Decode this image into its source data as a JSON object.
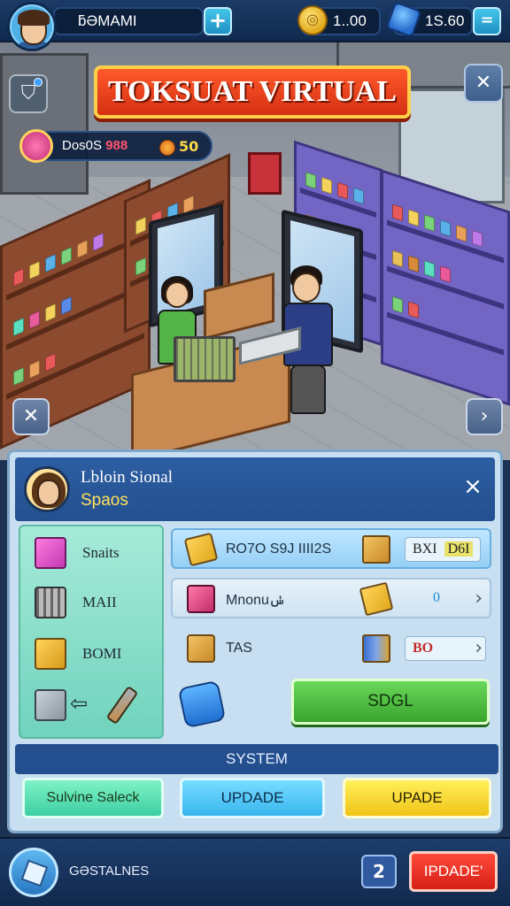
{
  "player": {
    "name": "ƃƏMAMI",
    "add_label": "+"
  },
  "currency": {
    "coins": "1..00",
    "gems": "1S.60",
    "menu_label": "="
  },
  "banner": {
    "title": "TOKSUAT VIRTUAL",
    "close_label": "✕"
  },
  "shop_info": {
    "label": "Dos0S",
    "value_red": "988",
    "coin_value": "50"
  },
  "nav": {
    "left_label": "✕",
    "right_label": "›"
  },
  "panel": {
    "name": "Lbloin Sional",
    "subtitle": "Spaos",
    "close_label": "×",
    "inventory": [
      {
        "label": "Snaits"
      },
      {
        "label": "MAII"
      },
      {
        "label": "BOMI"
      },
      {
        "label": "⇦"
      }
    ],
    "rows": [
      {
        "label": "RO7O S9J IIII2S",
        "tag": "BXI",
        "tag_accent": "D6I"
      },
      {
        "label": "Mnonuݭ",
        "tag": "0",
        "chevron": "›"
      },
      {
        "label": "TAS",
        "tag": "BO",
        "chevron": "›"
      }
    ],
    "sell_label": "SDGL",
    "system_label": "SYSTEM",
    "buttons": {
      "a": "Sulvine Saleck",
      "b": "UPDADE",
      "c": "UPADE"
    }
  },
  "bottom": {
    "label": "GƏSTALNES",
    "count": "2",
    "upgrade_label": "IPDADE'"
  },
  "colors": {
    "accent_red": "#d42f12",
    "accent_green": "#3aa42e",
    "accent_yellow": "#f0c417",
    "header_blue": "#23508f"
  }
}
